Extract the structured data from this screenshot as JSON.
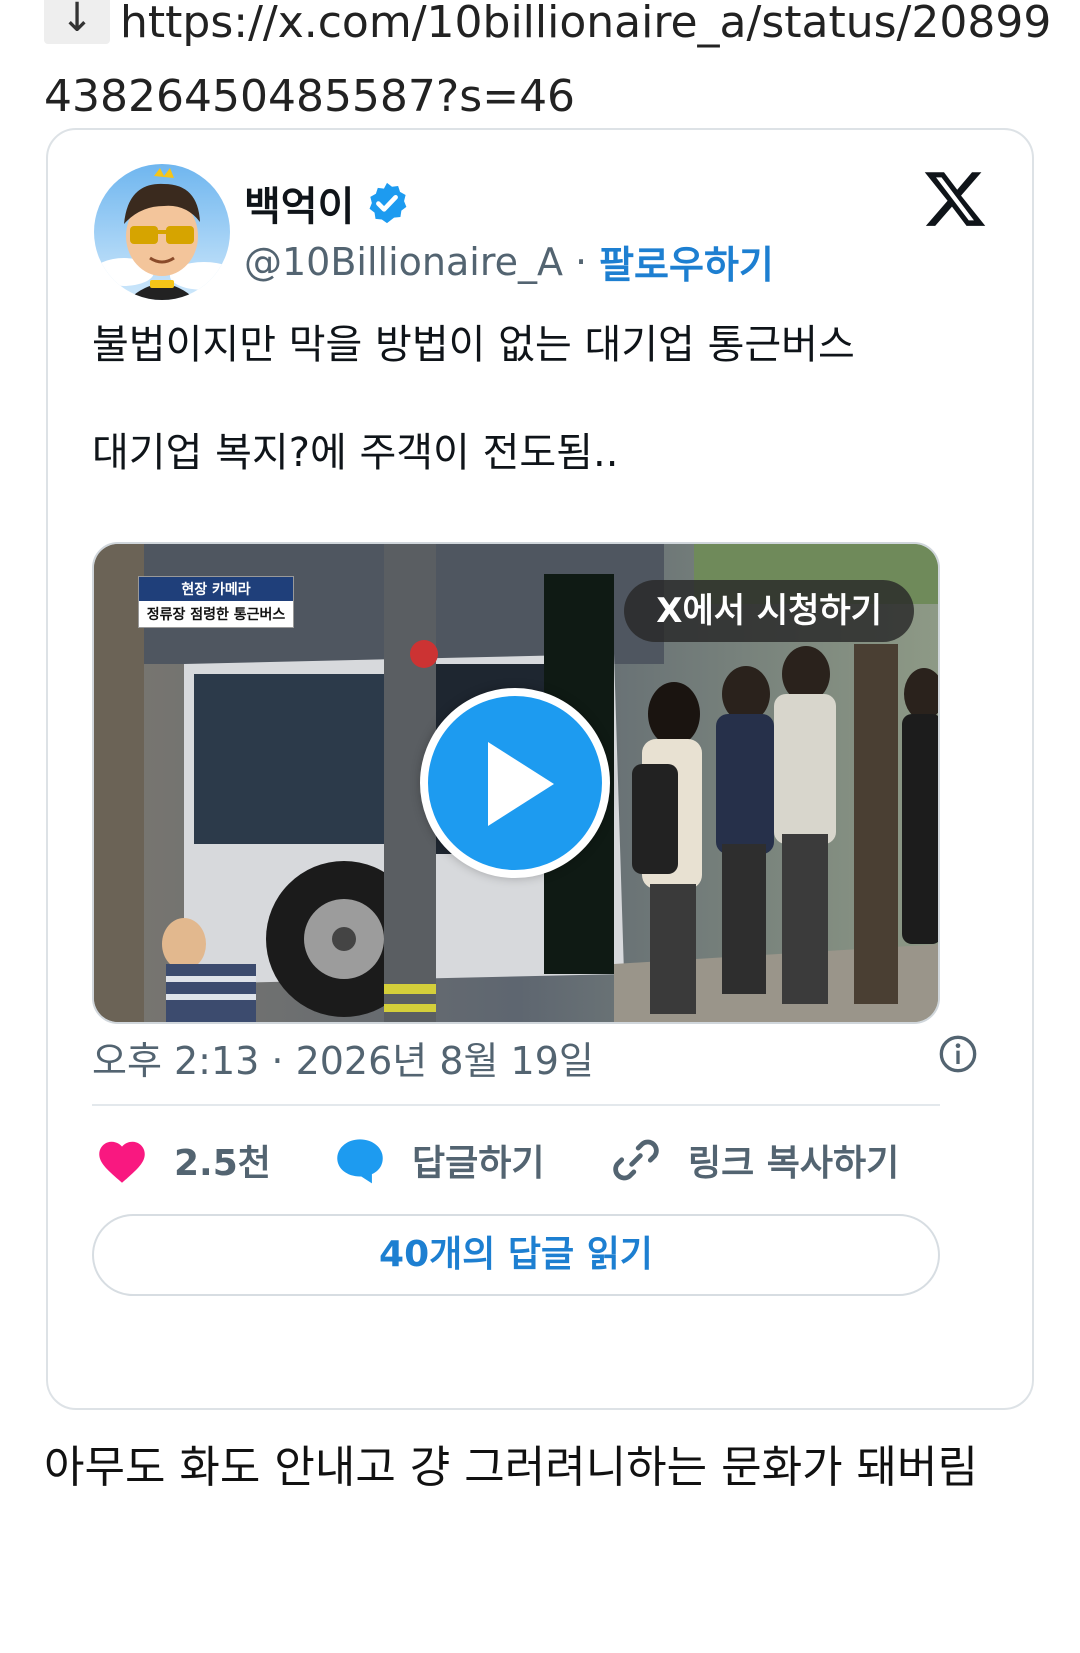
{
  "url": {
    "arrow": "↓",
    "text": "https://x.com/10billionaire_a/status/2089943826450485587?s=46"
  },
  "tweet": {
    "display_name": "백억이",
    "handle": "@10Billionaire_A",
    "separator": "·",
    "follow_label": "팔로우하기",
    "text_line1": "불법이지만 막을 방법이 없는 대기업 통근버스",
    "text_line2": "대기업 복지?에 주객이 전도됨..",
    "video": {
      "caption_top": "현장 카메라",
      "caption_bottom": "정류장 점령한 통근버스",
      "watch_label": "X에서 시청하기"
    },
    "timestamp": "오후 2:13 · 2026년 8월 19일",
    "likes": "2.5천",
    "reply_label": "답글하기",
    "copy_link_label": "링크 복사하기",
    "read_replies_label": "40개의 답글 읽기",
    "colors": {
      "like": "#f91880",
      "reply": "#1d9bf0",
      "follow": "#1d7fd1",
      "verified": "#1d9bf0"
    }
  },
  "comment": "아무도 화도 안내고 걍 그러려니하는 문화가 돼버림"
}
